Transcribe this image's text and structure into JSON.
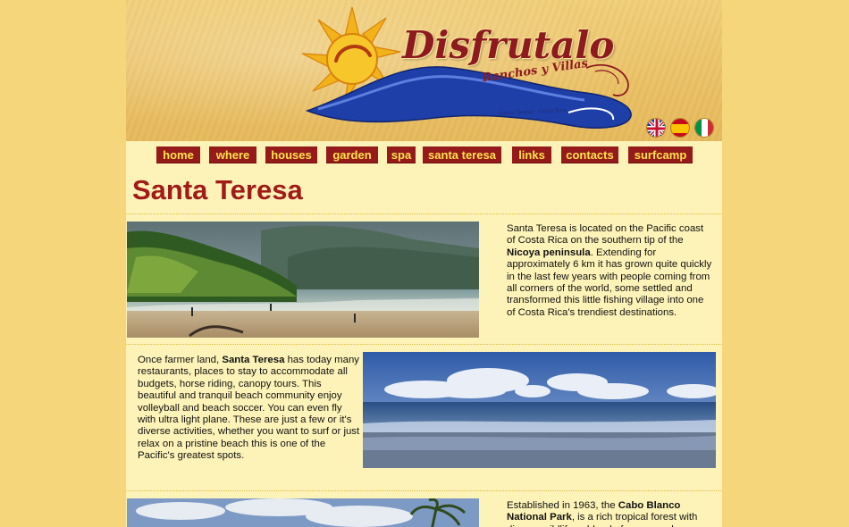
{
  "header": {
    "logo_title": "Disfrutalo",
    "logo_subtitle": "Ranchos y Villas",
    "logo_location": "Santa Teresa · Costa Rica",
    "colors": {
      "title": "#8c1a1e",
      "wave": "#1f3fa8",
      "sun": "#f2b21a"
    },
    "flags": [
      {
        "name": "uk-flag-icon"
      },
      {
        "name": "spain-flag-icon"
      },
      {
        "name": "italy-flag-icon"
      }
    ]
  },
  "nav": {
    "items": [
      {
        "label": "home"
      },
      {
        "label": "where"
      },
      {
        "label": "houses"
      },
      {
        "label": "garden"
      },
      {
        "label": "spa"
      },
      {
        "label": "santa teresa"
      },
      {
        "label": "links"
      },
      {
        "label": "contacts"
      },
      {
        "label": "surfcamp"
      }
    ],
    "colors": {
      "bg": "#951a1a",
      "text": "#ffe24c"
    }
  },
  "page": {
    "title": "Santa Teresa",
    "sections": [
      {
        "parts": [
          {
            "t": "Santa Teresa is located on the Pacific coast of Costa Rica on the southern tip of the "
          },
          {
            "t": "Nicoya peninsula",
            "bold": true
          },
          {
            "t": ". Extending for approximately 6 km it has grown quite quickly in the last few years with people coming from all corners of the world, some settled and transformed this little fishing village into one of Costa Rica's trendiest destinations."
          }
        ]
      },
      {
        "parts": [
          {
            "t": "Once farmer land, "
          },
          {
            "t": "Santa Teresa",
            "bold": true
          },
          {
            "t": " has today many restaurants, places to stay to accommodate all budgets, horse riding, canopy tours. This beautiful and tranquil beach community enjoy volleyball and beach soccer. You can even fly with ultra light plane. These are just a few or it's diverse activities, whether you want to surf or just relax on a pristine beach this is one of the Pacific's greatest spots."
          }
        ]
      },
      {
        "parts": [
          {
            "t": "Established in 1963, the "
          },
          {
            "t": "Cabo Blanco National Park",
            "bold": true
          },
          {
            "t": ", is a rich tropical forest with diverse wildlife, a blend of ocean and"
          }
        ]
      }
    ]
  }
}
